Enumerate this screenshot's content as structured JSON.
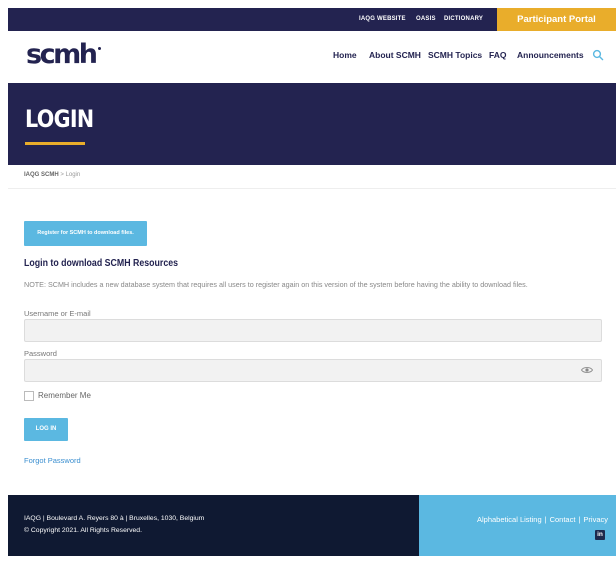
{
  "topbar": {
    "links": [
      "IAQG WEBSITE",
      "OASIS",
      "DICTIONARY"
    ],
    "portal": "Participant Portal"
  },
  "header": {
    "logo": "scmh",
    "nav": [
      "Home",
      "About SCMH",
      "SCMH Topics",
      "FAQ",
      "Announcements"
    ]
  },
  "hero": {
    "title": "LOGIN"
  },
  "breadcrumb": {
    "root": "IAQG SCMH",
    "separator": ">",
    "current": "Login"
  },
  "main": {
    "register_button": "Register for SCMH to download files.",
    "section_title": "Login to download SCMH Resources",
    "note": "NOTE: SCMH includes a new database system that requires all users to register again on this version of the system before having the ability to download files.",
    "username_label": "Username or E-mail",
    "username_value": "",
    "password_label": "Password",
    "password_value": "",
    "remember_label": "Remember Me",
    "login_button": "LOG IN",
    "forgot_link": "Forgot Password"
  },
  "footer": {
    "address": "IAQG | Boulevard A. Reyers 80 à | Bruxelles, 1030, Belgium",
    "copyright": "© Copyright 2021. All Rights Reserved.",
    "links": [
      "Alphabetical Listing",
      "Contact",
      "Privacy"
    ],
    "separator": "|",
    "social": "in"
  },
  "colors": {
    "navy": "#232350",
    "gold": "#e9ad2b",
    "sky": "#5bb8e1",
    "footer_dark": "#0f1932"
  },
  "icons": [
    "search-icon",
    "eye-icon",
    "linkedin-icon"
  ]
}
